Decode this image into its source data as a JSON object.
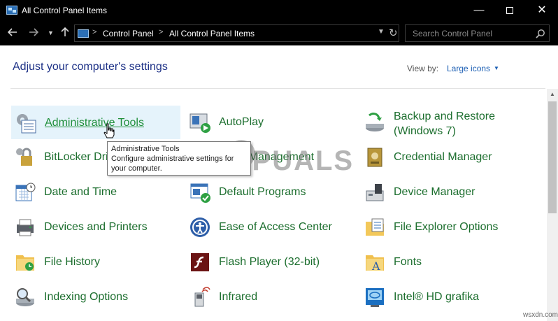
{
  "window": {
    "title": "All Control Panel Items",
    "minimize": "—",
    "close": "✕"
  },
  "address": {
    "breadcrumb": [
      "Control Panel",
      "All Control Panel Items"
    ],
    "separator": ">",
    "search_placeholder": "Search Control Panel"
  },
  "header": {
    "title": "Adjust your computer's settings",
    "view_by_label": "View by:",
    "view_by_value": "Large icons"
  },
  "items": [
    {
      "label": "Administrative Tools",
      "icon": "admin-tools-icon"
    },
    {
      "label": "AutoPlay",
      "icon": "autoplay-icon"
    },
    {
      "label": "Backup and Restore (Windows 7)",
      "icon": "backup-restore-icon"
    },
    {
      "label": "BitLocker Drive Encryption",
      "icon": "bitlocker-icon"
    },
    {
      "label": "Color Management",
      "icon": "color-management-icon"
    },
    {
      "label": "Credential Manager",
      "icon": "credential-manager-icon"
    },
    {
      "label": "Date and Time",
      "icon": "calendar-clock-icon"
    },
    {
      "label": "Default Programs",
      "icon": "default-programs-icon"
    },
    {
      "label": "Device Manager",
      "icon": "device-manager-icon"
    },
    {
      "label": "Devices and Printers",
      "icon": "printer-icon"
    },
    {
      "label": "Ease of Access Center",
      "icon": "ease-of-access-icon"
    },
    {
      "label": "File Explorer Options",
      "icon": "folder-options-icon"
    },
    {
      "label": "File History",
      "icon": "file-history-icon"
    },
    {
      "label": "Flash Player (32-bit)",
      "icon": "flash-player-icon"
    },
    {
      "label": "Fonts",
      "icon": "fonts-icon"
    },
    {
      "label": "Indexing Options",
      "icon": "indexing-icon"
    },
    {
      "label": "Infrared",
      "icon": "infrared-icon"
    },
    {
      "label": "Intel® HD grafika",
      "icon": "intel-graphics-icon"
    }
  ],
  "tooltip": {
    "title": "Administrative Tools",
    "line1": "Configure administrative settings for",
    "line2": "your computer."
  },
  "watermark": {
    "text": "A  PUALS"
  },
  "site": "wsxdn.com",
  "colors": {
    "link_green": "#1c6e2e",
    "heading_blue": "#1e3287",
    "hover_bg": "#e5f3fb",
    "titlebar": "#000000"
  }
}
